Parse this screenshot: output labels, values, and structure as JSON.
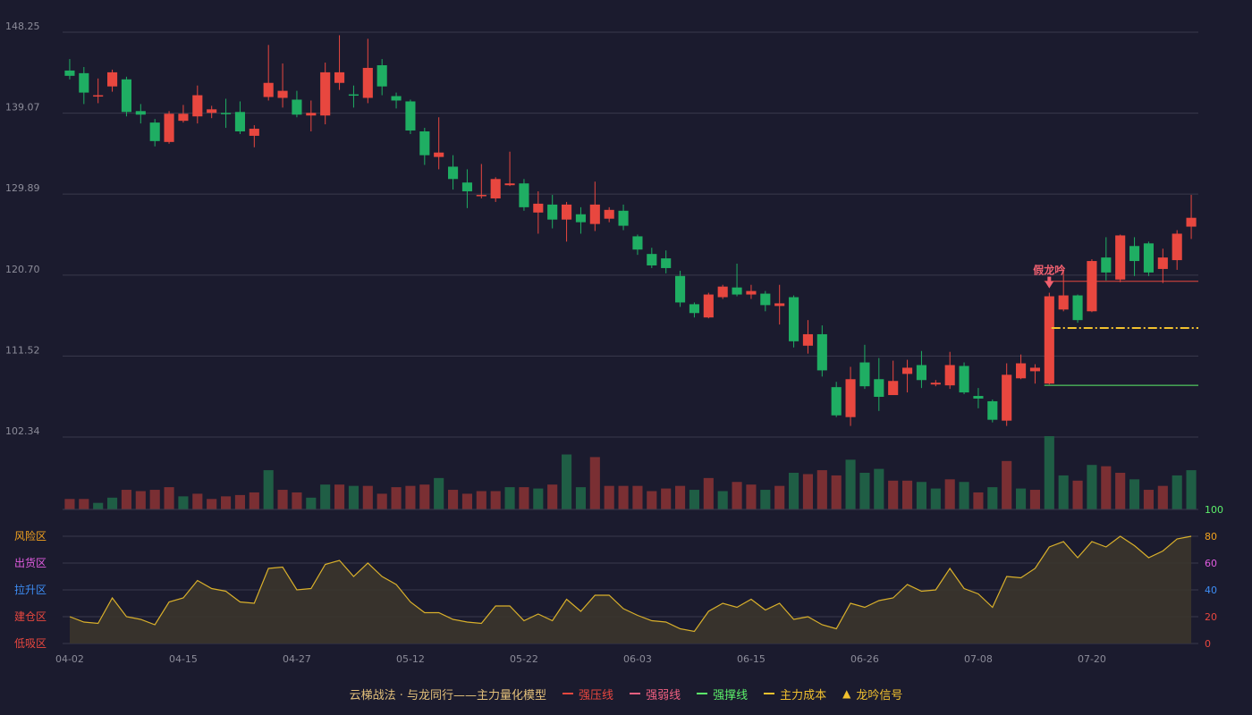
{
  "colors": {
    "background": "#1b1b2e",
    "grid": "#3a3a4c",
    "axis_text": "#8c8c99",
    "up": "#e8473f",
    "down": "#1fae63",
    "vol_up": "#7a2f33",
    "vol_down": "#1f5e45",
    "indicator_line": "#d9b02b",
    "indicator_fill": "#3b352c",
    "strong_pressure": "#e8473f",
    "weak_line": "#f06080",
    "support": "#5cf06a",
    "cost": "#f2c12e",
    "signal": "#f2c12e",
    "annotation": "#f06070"
  },
  "chart_data": {
    "type": "candlestick",
    "price_ticks": [
      "148.25",
      "139.07",
      "129.89",
      "120.70",
      "111.52",
      "102.34"
    ],
    "ylim": [
      102.34,
      148.25
    ],
    "date_ticks": [
      {
        "i": 0,
        "label": "04-02"
      },
      {
        "i": 8,
        "label": "04-15"
      },
      {
        "i": 16,
        "label": "04-27"
      },
      {
        "i": 24,
        "label": "05-12"
      },
      {
        "i": 32,
        "label": "05-22"
      },
      {
        "i": 40,
        "label": "06-03"
      },
      {
        "i": 48,
        "label": "06-15"
      },
      {
        "i": 56,
        "label": "06-26"
      },
      {
        "i": 64,
        "label": "07-08"
      },
      {
        "i": 72,
        "label": "07-20"
      }
    ],
    "candles": [
      [
        143.9,
        143.3,
        145.2,
        142.9
      ],
      [
        143.6,
        141.4,
        144.3,
        140.1
      ],
      [
        141.0,
        141.1,
        143.0,
        140.2
      ],
      [
        142.1,
        143.7,
        144.0,
        141.5
      ],
      [
        142.9,
        139.2,
        143.2,
        138.7
      ],
      [
        139.3,
        138.9,
        140.1,
        137.9
      ],
      [
        138.0,
        135.9,
        138.4,
        135.3
      ],
      [
        135.8,
        139.0,
        139.3,
        135.6
      ],
      [
        138.2,
        139.0,
        140.0,
        138.0
      ],
      [
        138.7,
        141.1,
        142.2,
        137.9
      ],
      [
        139.1,
        139.5,
        139.9,
        138.5
      ],
      [
        139.1,
        139.0,
        140.7,
        137.4
      ],
      [
        139.2,
        137.0,
        140.4,
        136.7
      ],
      [
        136.5,
        137.3,
        137.7,
        135.2
      ],
      [
        140.9,
        142.5,
        146.8,
        140.5
      ],
      [
        140.8,
        141.6,
        144.7,
        139.7
      ],
      [
        140.6,
        138.9,
        141.6,
        138.6
      ],
      [
        138.8,
        139.1,
        140.5,
        137.0
      ],
      [
        138.8,
        143.7,
        144.8,
        137.8
      ],
      [
        142.5,
        143.7,
        147.9,
        141.7
      ],
      [
        141.2,
        141.1,
        142.2,
        139.7
      ],
      [
        140.8,
        144.2,
        147.5,
        140.2
      ],
      [
        144.5,
        142.1,
        145.2,
        141.1
      ],
      [
        141.0,
        140.5,
        141.4,
        139.6
      ],
      [
        140.4,
        137.1,
        140.6,
        136.7
      ],
      [
        137.0,
        134.3,
        137.4,
        133.2
      ],
      [
        134.1,
        134.6,
        138.6,
        132.7
      ],
      [
        133.0,
        131.6,
        134.3,
        130.4
      ],
      [
        131.2,
        130.2,
        132.7,
        128.3
      ],
      [
        129.8,
        129.8,
        133.3,
        129.4
      ],
      [
        129.4,
        131.6,
        131.8,
        129.0
      ],
      [
        130.9,
        131.1,
        134.7,
        130.8
      ],
      [
        131.1,
        128.4,
        131.6,
        128.0
      ],
      [
        127.8,
        128.8,
        130.2,
        125.4
      ],
      [
        128.7,
        127.0,
        129.8,
        126.0
      ],
      [
        127.0,
        128.7,
        129.0,
        124.5
      ],
      [
        127.6,
        126.7,
        128.4,
        125.4
      ],
      [
        126.5,
        128.7,
        131.3,
        125.7
      ],
      [
        127.1,
        128.1,
        128.4,
        126.7
      ],
      [
        128.0,
        126.3,
        128.7,
        125.8
      ],
      [
        125.1,
        123.6,
        125.3,
        123.0
      ],
      [
        123.1,
        121.8,
        123.8,
        121.5
      ],
      [
        122.6,
        121.5,
        123.5,
        120.9
      ],
      [
        120.6,
        117.6,
        121.2,
        117.1
      ],
      [
        117.4,
        116.4,
        117.6,
        115.9
      ],
      [
        115.9,
        118.5,
        118.7,
        115.8
      ],
      [
        118.2,
        119.4,
        119.6,
        118.0
      ],
      [
        119.3,
        118.5,
        122.0,
        118.3
      ],
      [
        118.5,
        118.9,
        119.6,
        118.0
      ],
      [
        118.6,
        117.3,
        118.9,
        116.6
      ],
      [
        117.2,
        117.5,
        119.6,
        115.1
      ],
      [
        118.2,
        113.2,
        118.4,
        112.5
      ],
      [
        112.7,
        114.0,
        115.6,
        111.8
      ],
      [
        114.0,
        109.9,
        115.0,
        109.2
      ],
      [
        108.0,
        104.8,
        108.6,
        104.6
      ],
      [
        104.6,
        108.9,
        110.3,
        103.6
      ],
      [
        110.8,
        108.1,
        112.8,
        107.8
      ],
      [
        108.9,
        106.9,
        111.3,
        105.3
      ],
      [
        107.1,
        108.7,
        111.0,
        107.2
      ],
      [
        109.5,
        110.2,
        111.1,
        107.4
      ],
      [
        110.5,
        108.8,
        112.1,
        107.9
      ],
      [
        108.3,
        108.5,
        108.8,
        108.1
      ],
      [
        108.2,
        110.5,
        112.0,
        107.8
      ],
      [
        110.4,
        107.4,
        110.8,
        107.2
      ],
      [
        107.0,
        106.7,
        107.9,
        105.6
      ],
      [
        106.4,
        104.3,
        106.6,
        104.0
      ],
      [
        104.2,
        109.4,
        110.7,
        103.6
      ],
      [
        109.0,
        110.7,
        111.7,
        108.9
      ],
      [
        109.8,
        110.2,
        110.6,
        108.4
      ],
      [
        108.4,
        118.3,
        118.7,
        108.3
      ],
      [
        116.8,
        118.4,
        121.5,
        116.6
      ],
      [
        118.4,
        115.6,
        118.5,
        115.3
      ],
      [
        116.6,
        122.3,
        122.5,
        116.5
      ],
      [
        122.7,
        121.0,
        125.0,
        120.1
      ],
      [
        120.2,
        125.2,
        125.3,
        119.9
      ],
      [
        124.0,
        122.3,
        125.0,
        120.6
      ],
      [
        124.3,
        121.0,
        124.5,
        120.6
      ],
      [
        121.4,
        122.7,
        123.7,
        119.8
      ],
      [
        122.4,
        125.4,
        125.8,
        121.3
      ],
      [
        126.2,
        127.2,
        129.8,
        124.8
      ]
    ],
    "volume_up": [
      true,
      true,
      false,
      false,
      true,
      true,
      true,
      true,
      false,
      true,
      true,
      true,
      true,
      true,
      false,
      true,
      true,
      false,
      false,
      true,
      false,
      true,
      true,
      true,
      true,
      true,
      false,
      true,
      true,
      true,
      true,
      false,
      true,
      false,
      true,
      false,
      false,
      true,
      true,
      true,
      true,
      true,
      true,
      true,
      false,
      true,
      false,
      true,
      true,
      false,
      true,
      false,
      true,
      true,
      true,
      false,
      false,
      false,
      true,
      true,
      false,
      false,
      true,
      false,
      true,
      false,
      true,
      false,
      true,
      false,
      false,
      true,
      false,
      true,
      true,
      false,
      true,
      true,
      false,
      false
    ],
    "volumes": [
      8,
      8,
      5,
      9,
      15,
      14,
      15,
      17,
      10,
      12,
      8,
      10,
      11,
      13,
      30,
      15,
      13,
      9,
      19,
      19,
      18,
      18,
      12,
      17,
      18,
      19,
      24,
      15,
      12,
      14,
      14,
      17,
      17,
      16,
      19,
      42,
      17,
      40,
      18,
      18,
      18,
      14,
      16,
      18,
      15,
      24,
      14,
      21,
      19,
      15,
      18,
      28,
      27,
      30,
      26,
      38,
      28,
      31,
      22,
      22,
      21,
      16,
      23,
      21,
      13,
      17,
      37,
      16,
      15,
      56,
      26,
      22,
      34,
      33,
      28,
      23,
      15,
      18,
      26,
      30
    ],
    "indicator": {
      "label": "主力量化模型",
      "zones": [
        "风险区",
        "出货区",
        "拉升区",
        "建仓区",
        "低吸区"
      ],
      "zone_colors": [
        "#f2a21e",
        "#e05ce0",
        "#3d8df5",
        "#e8473f",
        "#e8473f"
      ],
      "ticks": [
        "100",
        "80",
        "60",
        "40",
        "20",
        "0"
      ],
      "tick_colors": [
        "#5cf06a",
        "#f2a21e",
        "#e05ce0",
        "#3d8df5",
        "#e8473f",
        "#e8473f"
      ],
      "ylim": [
        0,
        100
      ],
      "values": [
        20,
        16,
        15,
        34,
        20,
        18,
        14,
        31,
        34,
        47,
        41,
        39,
        31,
        30,
        56,
        57,
        40,
        41,
        59,
        62,
        50,
        60,
        50,
        44,
        31,
        23,
        23,
        18,
        16,
        15,
        28,
        28,
        17,
        22,
        17,
        33,
        24,
        36,
        36,
        26,
        21,
        17,
        16,
        11,
        9,
        24,
        30,
        27,
        33,
        25,
        30,
        18,
        20,
        14,
        11,
        30,
        27,
        32,
        34,
        44,
        39,
        40,
        56,
        41,
        37,
        27,
        50,
        49,
        56,
        72,
        76,
        64,
        76,
        72,
        80,
        73,
        64,
        69,
        78,
        80
      ]
    },
    "lines": {
      "strong_pressure": {
        "start": 69,
        "value": 120.0
      },
      "cost": {
        "start": 69,
        "value": 114.7
      },
      "support": {
        "start": 69,
        "value": 108.2
      }
    },
    "annotation": {
      "text": "假龙吟",
      "index": 69
    }
  },
  "legend": {
    "title": "云梯战法 · 与龙同行——主力量化模型",
    "items": [
      {
        "label": "强压线",
        "color": "#e8473f",
        "style": "solid"
      },
      {
        "label": "强弱线",
        "color": "#f06080",
        "style": "dashed"
      },
      {
        "label": "强撑线",
        "color": "#5cf06a",
        "style": "solid"
      },
      {
        "label": "主力成本",
        "color": "#f2c12e",
        "style": "dashed"
      },
      {
        "label": "龙吟信号",
        "color": "#f2c12e",
        "style": "triangle"
      }
    ]
  }
}
